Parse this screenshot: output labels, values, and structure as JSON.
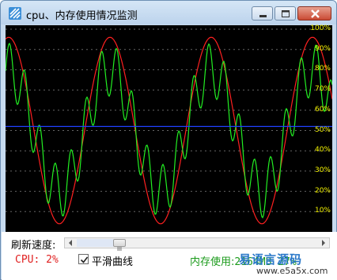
{
  "window": {
    "title": "cpu、内存使用情况监测",
    "icon": "app-icon-stripes"
  },
  "controls": {
    "minimize_icon": "minimize-icon",
    "maximize_icon": "maximize-icon",
    "close_icon": "close-icon"
  },
  "graph": {
    "background": "#000000",
    "y_ticks": [
      "100%",
      "90%",
      "80%",
      "70%",
      "60%",
      "50%",
      "40%",
      "30%",
      "20%",
      "10%"
    ],
    "midline_level": 52,
    "colors": {
      "cpu_curve": "#ff2020",
      "mem_curve": "#22ee22",
      "midline": "#2040ff",
      "grid": "#666666",
      "tick_label": "#f5f500"
    }
  },
  "speed": {
    "label": "刷新速度:",
    "slider_value": 0.2
  },
  "status": {
    "cpu_text": "CPU: 2%",
    "smooth_checkbox_label": "平滑曲线",
    "smooth_checked": true,
    "mem_label": "内存使用:",
    "mem_value": "2164MB 27%"
  },
  "watermark": {
    "line1": "易语言源码",
    "line2": "www.e5a5x.com"
  }
}
